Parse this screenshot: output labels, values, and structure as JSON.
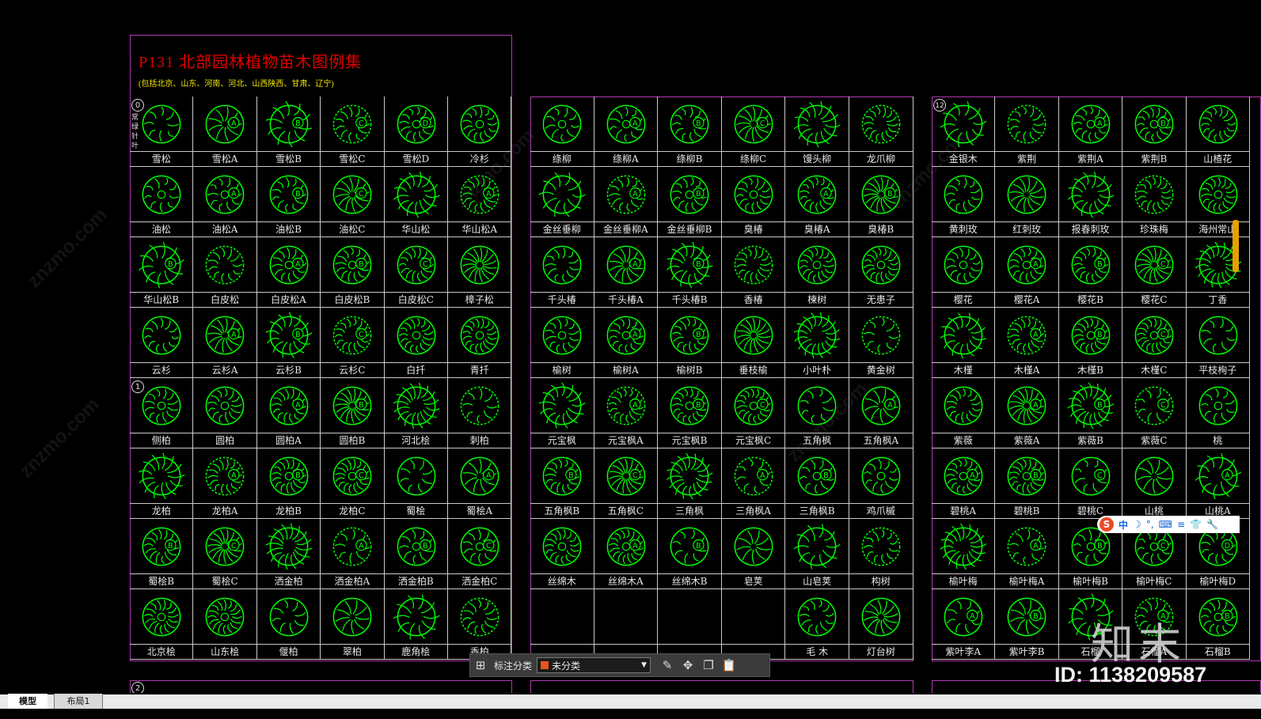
{
  "header": {
    "title": "P131  北部园林植物苗木图例集",
    "subtitle": "(包括北京、山东、河南、河北、山西陕西、甘肃、辽宁)",
    "section_vertical": "常绿针叶"
  },
  "sections": [
    "0",
    "1",
    "2",
    "12"
  ],
  "panels": [
    {
      "rows": [
        [
          "雪松",
          "雪松A",
          "雪松B",
          "雪松C",
          "雪松D",
          "冷杉"
        ],
        [
          "油松",
          "油松A",
          "油松B",
          "油松C",
          "华山松",
          "华山松A"
        ],
        [
          "华山松B",
          "白皮松",
          "白皮松A",
          "白皮松B",
          "白皮松C",
          "樟子松"
        ],
        [
          "云杉",
          "云杉A",
          "云杉B",
          "云杉C",
          "白扦",
          "青扦"
        ],
        [
          "侧柏",
          "圆柏",
          "圆柏A",
          "圆柏B",
          "河北桧",
          "刺柏"
        ],
        [
          "龙柏",
          "龙柏A",
          "龙柏B",
          "龙柏C",
          "蜀桧",
          "蜀桧A"
        ],
        [
          "蜀桧B",
          "蜀桧C",
          "洒金柏",
          "洒金柏A",
          "洒金柏B",
          "洒金柏C"
        ],
        [
          "北京桧",
          "山东桧",
          "偃柏",
          "翠柏",
          "鹿角桧",
          "香柏"
        ]
      ]
    },
    {
      "rows": [
        [
          "绦柳",
          "绦柳A",
          "绦柳B",
          "绦柳C",
          "馒头柳",
          "龙爪柳"
        ],
        [
          "金丝垂柳",
          "金丝垂柳A",
          "金丝垂柳B",
          "臭椿",
          "臭椿A",
          "臭椿B"
        ],
        [
          "千头椿",
          "千头椿A",
          "千头椿B",
          "香椿",
          "楝树",
          "无患子"
        ],
        [
          "榆树",
          "榆树A",
          "榆树B",
          "垂枝榆",
          "小叶朴",
          "黄金树"
        ],
        [
          "元宝枫",
          "元宝枫A",
          "元宝枫B",
          "元宝枫C",
          "五角枫",
          "五角枫A"
        ],
        [
          "五角枫B",
          "五角枫C",
          "三角枫",
          "三角枫A",
          "三角枫B",
          "鸡爪槭"
        ],
        [
          "丝绵木",
          "丝绵木A",
          "丝绵木B",
          "皂荚",
          "山皂荚",
          "构树"
        ],
        [
          "",
          "",
          "",
          "",
          "毛 木",
          "灯台树"
        ]
      ]
    },
    {
      "rows": [
        [
          "金银木",
          "紫荆",
          "紫荆A",
          "紫荆B",
          "山楂花"
        ],
        [
          "黄刺玫",
          "红刺玫",
          "报春刺玫",
          "珍珠梅",
          "海州常山"
        ],
        [
          "樱花",
          "樱花A",
          "樱花B",
          "樱花C",
          "丁香"
        ],
        [
          "木槿",
          "木槿A",
          "木槿B",
          "木槿C",
          "平枝栒子"
        ],
        [
          "紫薇",
          "紫薇A",
          "紫薇B",
          "紫薇C",
          "桃"
        ],
        [
          "碧桃A",
          "碧桃B",
          "碧桃C",
          "山桃",
          "山桃A"
        ],
        [
          "榆叶梅",
          "榆叶梅A",
          "榆叶梅B",
          "榆叶梅C",
          "榆叶梅D"
        ],
        [
          "紫叶李A",
          "紫叶李B",
          "石榴",
          "石榴A",
          "石榴B"
        ]
      ]
    }
  ],
  "toolbar": {
    "label": "标注分类",
    "dropdown_value": "未分类",
    "swatch_color": "#e8551c"
  },
  "tabs": [
    "模型",
    "布局1"
  ],
  "watermark": {
    "text": "znzmo.com",
    "brand": "知末",
    "id_text": "ID: 1138209587"
  },
  "ime": [
    "中",
    "☽",
    "°,",
    "⌨",
    "≡",
    "👕",
    "🔧"
  ],
  "colors": {
    "symbol": "#00ff00",
    "panel_border": "#b03ab0",
    "title": "#e00000",
    "subtitle": "#f2e600"
  }
}
